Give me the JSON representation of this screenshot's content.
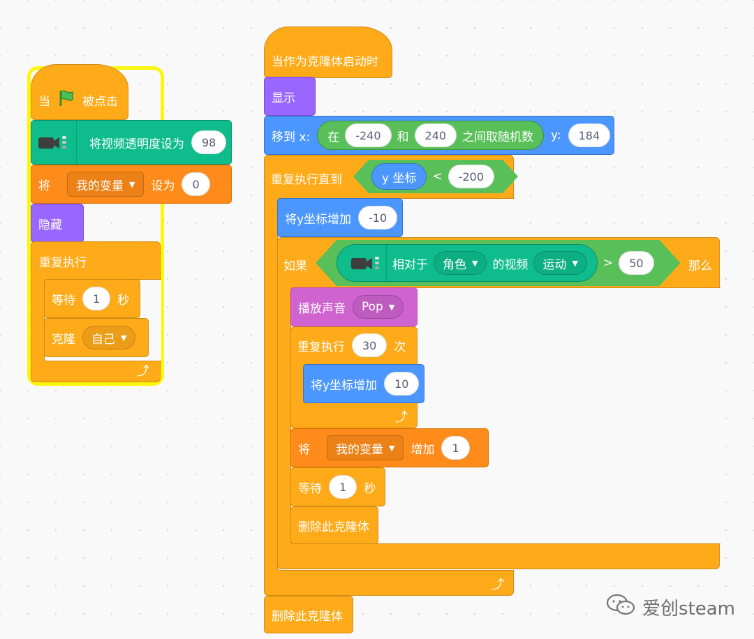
{
  "left_script": {
    "when_flag": {
      "prefix": "当",
      "suffix": "被点击"
    },
    "set_video_transparency": {
      "label": "将视频透明度设为",
      "value": "98"
    },
    "set_variable": {
      "prefix": "将",
      "variable": "我的变量",
      "mid": "设为",
      "value": "0"
    },
    "hide": {
      "label": "隐藏"
    },
    "forever": {
      "label": "重复执行"
    },
    "wait": {
      "label": "等待",
      "value": "1",
      "unit": "秒"
    },
    "clone": {
      "label": "克隆",
      "target": "自己"
    }
  },
  "right_script": {
    "when_clone": {
      "label": "当作为克隆体启动时"
    },
    "show": {
      "label": "显示"
    },
    "goto": {
      "label": "移到 x:",
      "rand_prefix": "在",
      "from": "-240",
      "and": "和",
      "to": "240",
      "rand_suffix": "之间取随机数",
      "ylabel": "y:",
      "y": "184"
    },
    "repeat_until": {
      "label": "重复执行直到",
      "reporter": "y 坐标",
      "op": "<",
      "value": "-200"
    },
    "change_y_1": {
      "label": "将y坐标增加",
      "value": "-10"
    },
    "if_block": {
      "label": "如果",
      "relative": "相对于",
      "target": "角色",
      "video": "的视频",
      "attribute": "运动",
      "op": ">",
      "value": "50",
      "then": "那么"
    },
    "play_sound": {
      "label": "播放声音",
      "sound": "Pop"
    },
    "repeat": {
      "label": "重复执行",
      "times": "30",
      "suffix": "次"
    },
    "change_y_2": {
      "label": "将y坐标增加",
      "value": "10"
    },
    "change_var": {
      "prefix": "将",
      "variable": "我的变量",
      "mid": "增加",
      "value": "1"
    },
    "wait": {
      "label": "等待",
      "value": "1",
      "unit": "秒"
    },
    "delete_clone_inner": {
      "label": "删除此克隆体"
    },
    "delete_clone_end": {
      "label": "删除此克隆体"
    }
  },
  "watermark": {
    "text": "爱创steam",
    "icon": "wechat-icon"
  },
  "colors": {
    "control": "#ffab19",
    "looks": "#9966ff",
    "motion": "#4c97ff",
    "video": "#0fbd8c",
    "variables": "#ff8c1a",
    "sound": "#cf63cf",
    "operators": "#59c059",
    "highlight": "#fbf60e"
  }
}
